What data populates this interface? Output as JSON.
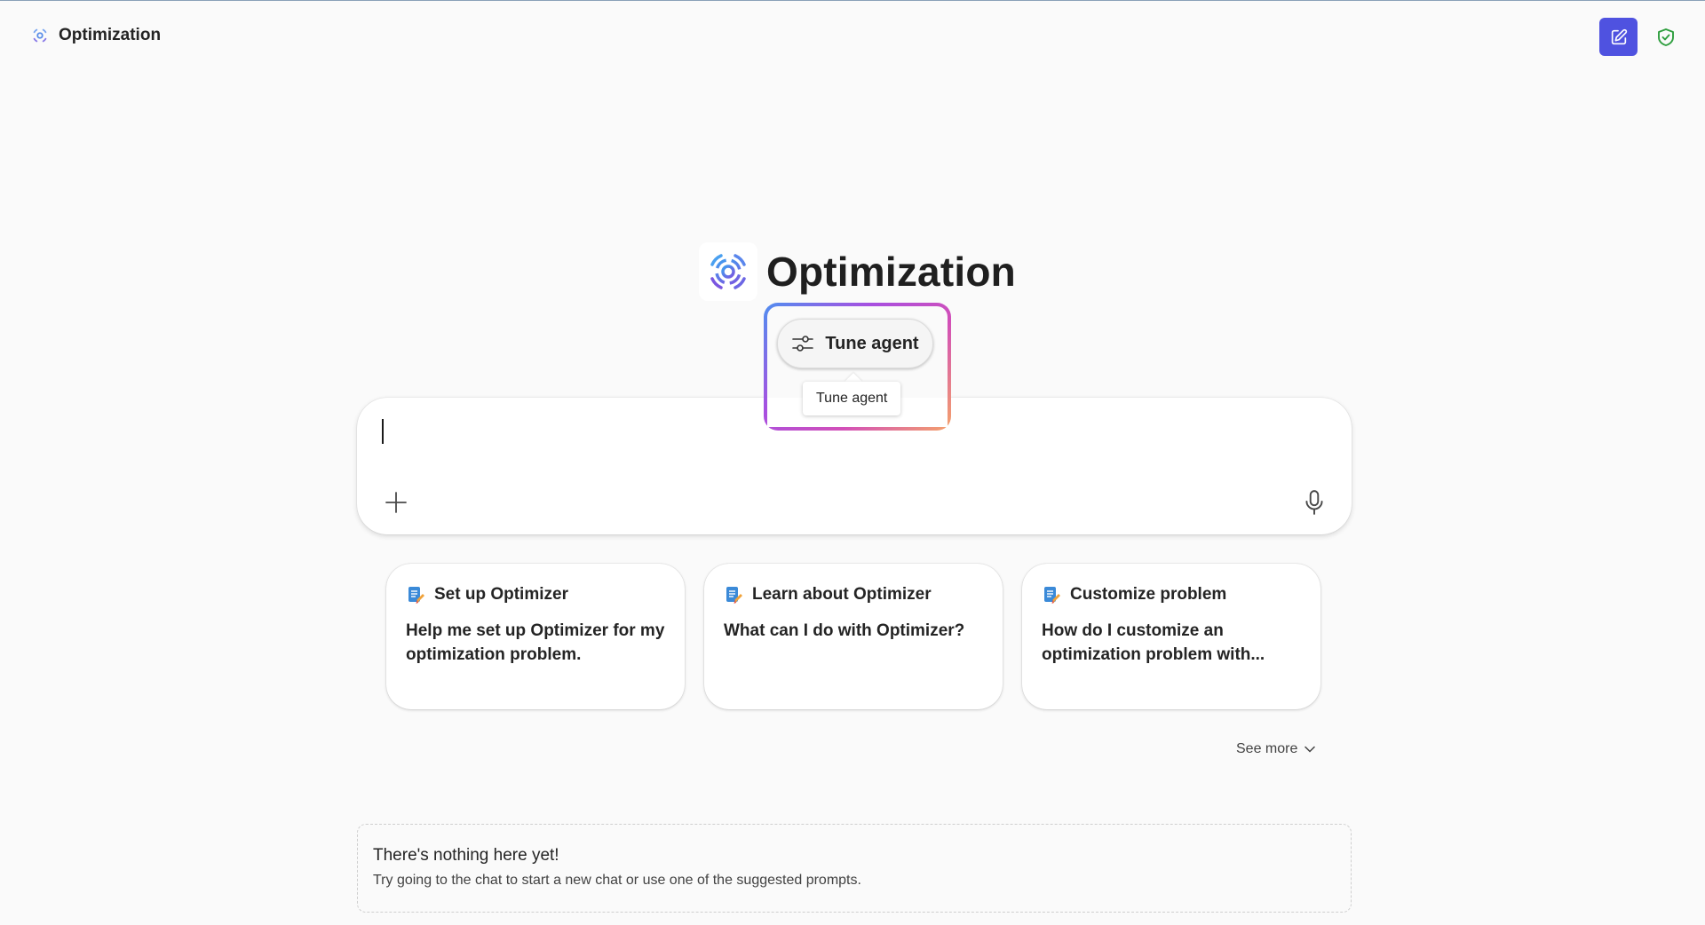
{
  "header": {
    "app_name": "Optimization",
    "icons": {
      "logo": "optimization-logo-icon",
      "new_chat": "edit-icon",
      "shield": "shield-check-icon"
    }
  },
  "hero": {
    "title": "Optimization"
  },
  "tune_agent": {
    "label": "Tune agent",
    "tooltip": "Tune agent",
    "icon": "sliders-icon"
  },
  "chat": {
    "value": "",
    "placeholder": "",
    "attach_icon": "plus-icon",
    "mic_icon": "microphone-icon"
  },
  "suggestions": [
    {
      "title": "Set up Optimizer",
      "body": "Help me set up Optimizer for my optimization problem."
    },
    {
      "title": "Learn about Optimizer",
      "body": "What can I do with Optimizer?"
    },
    {
      "title": "Customize problem",
      "body": "How do I customize an optimization problem with..."
    }
  ],
  "see_more": {
    "label": "See more"
  },
  "empty_state": {
    "title": "There's nothing here yet!",
    "subtitle": "Try going to the chat to start a new chat or use one of the suggested prompts."
  },
  "colors": {
    "primary": "#4f52e0",
    "shield": "#2e9e3e",
    "background": "#fafafa"
  }
}
